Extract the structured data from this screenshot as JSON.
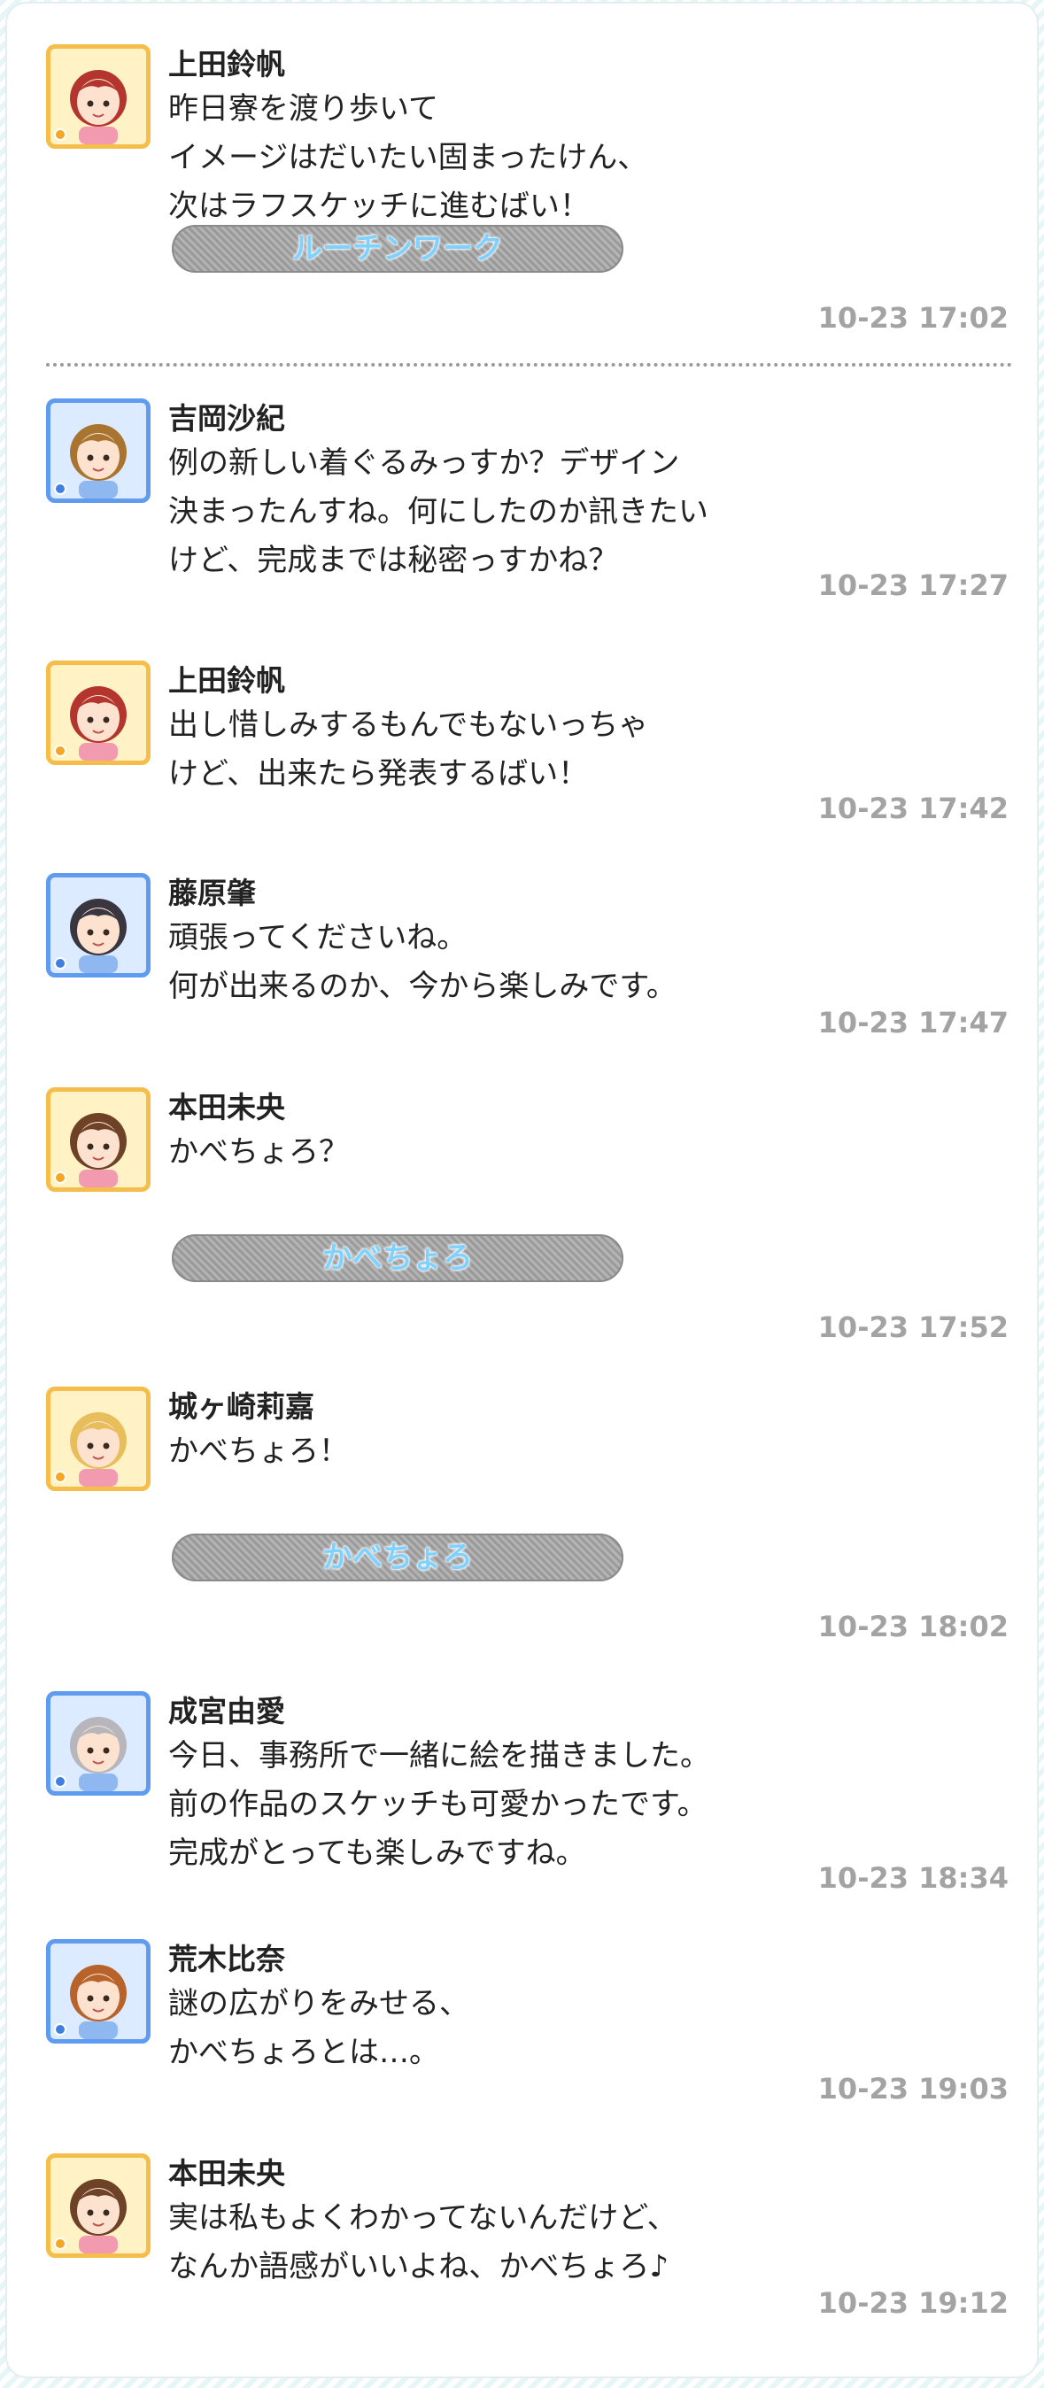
{
  "messages": [
    {
      "name": "上田鈴帆",
      "text": "昨日寮を渡り歩いて\nイメージはだいたい固まったけん、\n次はラフスケッチに進むばい！",
      "tag": "ルーチンワーク",
      "time": "10-23 17:02",
      "type": "cute",
      "hair": "#b3352e"
    },
    {
      "name": "吉岡沙紀",
      "text": "例の新しい着ぐるみっすか？デザイン\n決まったんすね。何にしたのか訊きたい\nけど、完成までは秘密っすかね？",
      "time": "10-23 17:27",
      "type": "cool",
      "hair": "#a8742f"
    },
    {
      "name": "上田鈴帆",
      "text": "出し惜しみするもんでもないっちゃ\nけど、出来たら発表するばい！",
      "time": "10-23 17:42",
      "type": "cute",
      "hair": "#b3352e"
    },
    {
      "name": "藤原肇",
      "text": "頑張ってくださいね。\n何が出来るのか、今から楽しみです。",
      "time": "10-23 17:47",
      "type": "cool",
      "hair": "#3a3640"
    },
    {
      "name": "本田未央",
      "text": "かべちょろ？",
      "tag": "かべちょろ",
      "time": "10-23 17:52",
      "type": "cute",
      "hair": "#6e4227"
    },
    {
      "name": "城ヶ崎莉嘉",
      "text": "かべちょろ！",
      "tag": "かべちょろ",
      "time": "10-23 18:02",
      "type": "cute",
      "hair": "#e8be5c"
    },
    {
      "name": "成宮由愛",
      "text": "今日、事務所で一緒に絵を描きました。\n前の作品のスケッチも可愛かったです。\n完成がとっても楽しみですね。",
      "time": "10-23 18:34",
      "type": "cool",
      "hair": "#b6b6bc"
    },
    {
      "name": "荒木比奈",
      "text": "謎の広がりをみせる、\nかべちょろとは…。",
      "time": "10-23 19:03",
      "type": "cool",
      "hair": "#b7632b"
    },
    {
      "name": "本田未央",
      "text": "実は私もよくわかってないんだけど、\nなんか語感がいいよね、かべちょろ♪",
      "time": "10-23 19:12",
      "type": "cute",
      "hair": "#6e4227"
    }
  ]
}
